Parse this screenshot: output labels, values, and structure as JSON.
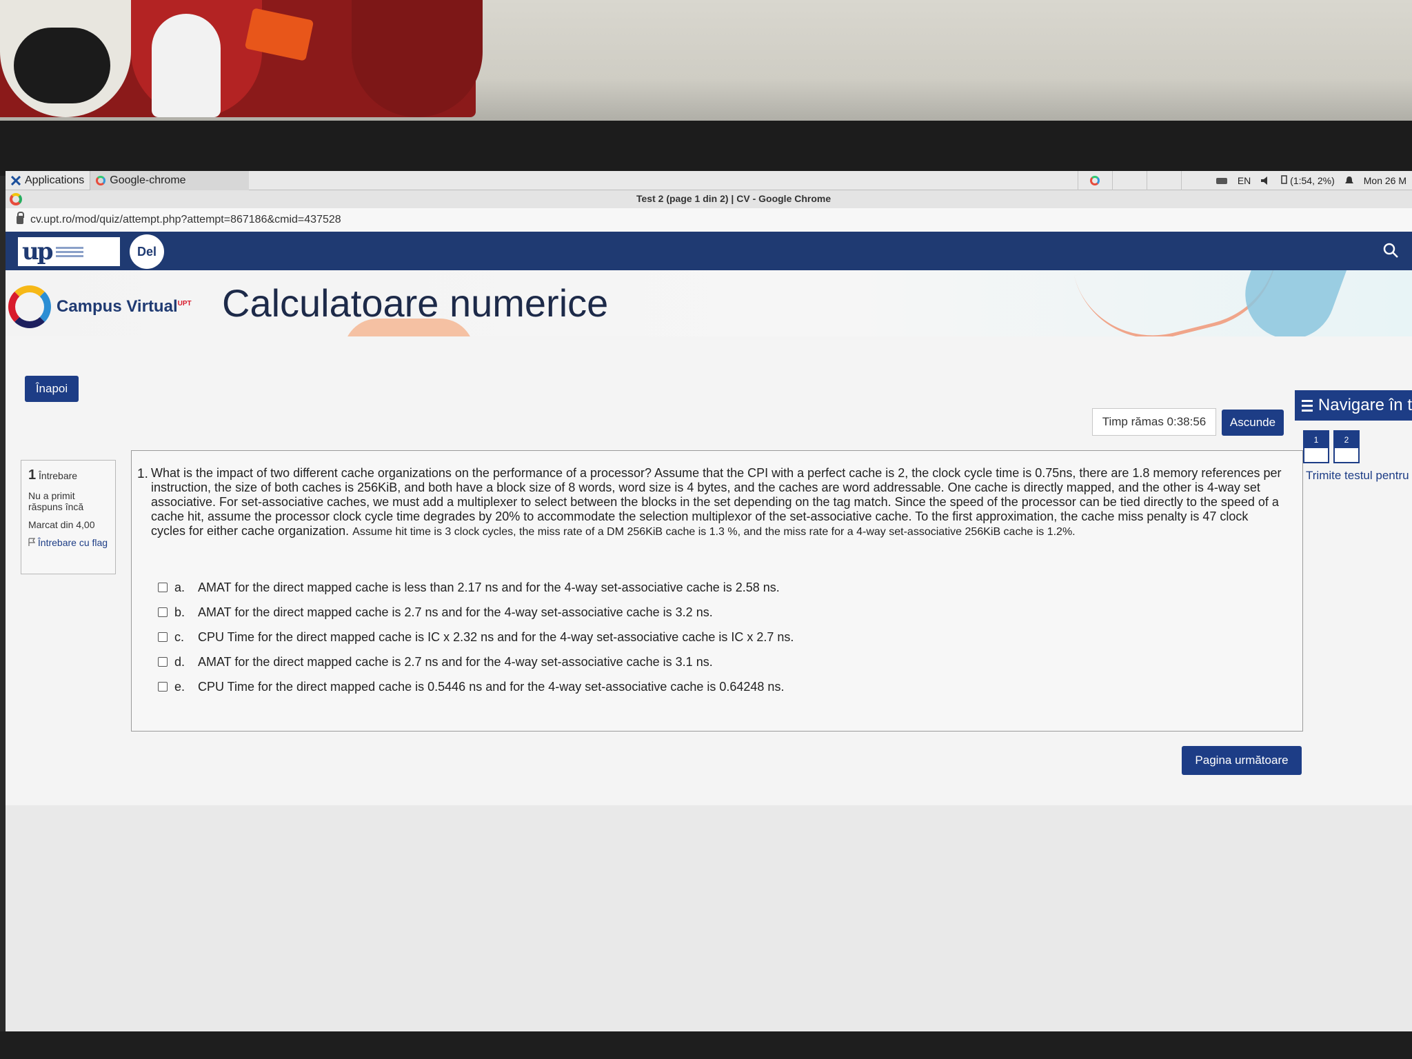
{
  "os_panel": {
    "applications": "Applications",
    "task": "Google-chrome",
    "lang": "EN",
    "battery": "(1:54, 2%)",
    "clock": "Mon 26 M"
  },
  "browser": {
    "title": "Test 2 (page 1 din 2) | CV - Google Chrome",
    "url": "cv.upt.ro/mod/quiz/attempt.php?attempt=867186&cmid=437528"
  },
  "site": {
    "del_logo": "Del",
    "campus_name": "Campus Virtual",
    "campus_sup": "UPT",
    "course_title": "Calculatoare numerice"
  },
  "toolbar": {
    "back_label": "Înapoi",
    "timer": "Timp rămas 0:38:56",
    "hide_label": "Ascunde"
  },
  "quiz_nav": {
    "title": "Navigare în t",
    "tiles": [
      "1",
      "2"
    ],
    "submit_link": "Trimite testul pentru"
  },
  "question_info": {
    "number": "1",
    "label": "Întrebare",
    "status": "Nu a primit răspuns încă",
    "marks": "Marcat din 4,00",
    "flag": "Întrebare cu flag"
  },
  "question": {
    "number": "1.",
    "text_main": "What is the impact of two different cache organizations on the performance of a processor? Assume that the CPI with a perfect cache is 2, the clock cycle time is 0.75ns, there are 1.8 memory references per instruction, the size of both caches is 256KiB, and both have a block size of 8 words, word size is 4 bytes, and the caches are word addressable. One cache is directly mapped, and the other is 4-way set associative. For set-associative caches, we must add a multiplexer to select between the blocks in the set depending on the tag match. Since the speed of the processor can be tied directly to the speed of a cache hit, assume the processor clock cycle time degrades by 20% to accommodate the selection multiplexor of the set-associative cache. To the first approximation, the cache miss penalty is 47 clock cycles for either cache organization.",
    "text_extra": "Assume hit time is 3 clock cycles, the miss rate of a DM 256KiB cache is 1.3 %, and the miss rate for a 4-way set-associative 256KiB cache is 1.2%.",
    "options": [
      {
        "letter": "a.",
        "text": "AMAT for the direct mapped cache is less than 2.17 ns and for the 4-way set-associative cache is 2.58 ns."
      },
      {
        "letter": "b.",
        "text": "AMAT for the direct mapped cache is 2.7 ns and for the 4-way set-associative cache is 3.2 ns."
      },
      {
        "letter": "c.",
        "text": "CPU Time for the direct mapped cache is IC x 2.32 ns and for the 4-way set-associative cache is IC x 2.7 ns."
      },
      {
        "letter": "d.",
        "text": "AMAT for the direct mapped cache is 2.7 ns and for the 4-way set-associative cache is 3.1 ns."
      },
      {
        "letter": "e.",
        "text": "CPU Time for the direct mapped cache is 0.5446 ns and for the 4-way set-associative cache is 0.64248 ns."
      }
    ]
  },
  "footer": {
    "next_label": "Pagina următoare"
  },
  "colors": {
    "brand_navy": "#1f3a72",
    "button_blue": "#1d3d86",
    "accent_red": "#d81b2c"
  }
}
